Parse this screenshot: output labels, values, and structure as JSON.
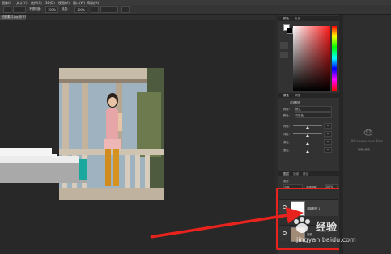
{
  "menubar": {
    "items": [
      "图像(I)",
      "文字(Y)",
      "选择(S)",
      "3D(D)",
      "视图(V)",
      "窗口(W)",
      "帮助(H)"
    ]
  },
  "options_bar": {
    "opacity_label": "不透明度:",
    "opacity_value": "100%",
    "flow_label": "流量:",
    "flow_value": "100%"
  },
  "document_tab": {
    "title": "拍照素材.jpg @ 75%"
  },
  "color_panel": {
    "tabs": [
      "颜色",
      "色板"
    ]
  },
  "adjust_panel": {
    "tabs": [
      "属性",
      "调整"
    ],
    "section_title": "可选颜色",
    "preset_label": "预设:",
    "preset_value": "默认",
    "colors_label": "颜色:",
    "colors_value": "中性色",
    "rows": [
      {
        "label": "青色:",
        "value": "0",
        "thumb": 0.5
      },
      {
        "label": "洋红:",
        "value": "0",
        "thumb": 0.5
      },
      {
        "label": "黄色:",
        "value": "0",
        "thumb": 0.5
      },
      {
        "label": "黑色:",
        "value": "0",
        "thumb": 0.5
      }
    ]
  },
  "layers_panel": {
    "tabs": [
      "图层",
      "通道",
      "路径"
    ],
    "kind_label": "类型",
    "blend_mode": "正常",
    "opacity_label": "不透明度:",
    "opacity_value": "100%",
    "lock_label": "锁定:",
    "fill_label": "填充:",
    "fill_value": "100%",
    "layers": [
      {
        "name": "选取颜色 1"
      },
      {
        "name": "背景"
      }
    ]
  },
  "libraries_panel": {
    "message": "使用 Creative Cloud 库(CC)",
    "action": "登录以使用"
  },
  "watermark": {
    "brand": "经验",
    "url": "jingyan.baidu.com"
  },
  "colors": {
    "highlight": "#e8231d",
    "accent_teal": "#1aa79d"
  }
}
